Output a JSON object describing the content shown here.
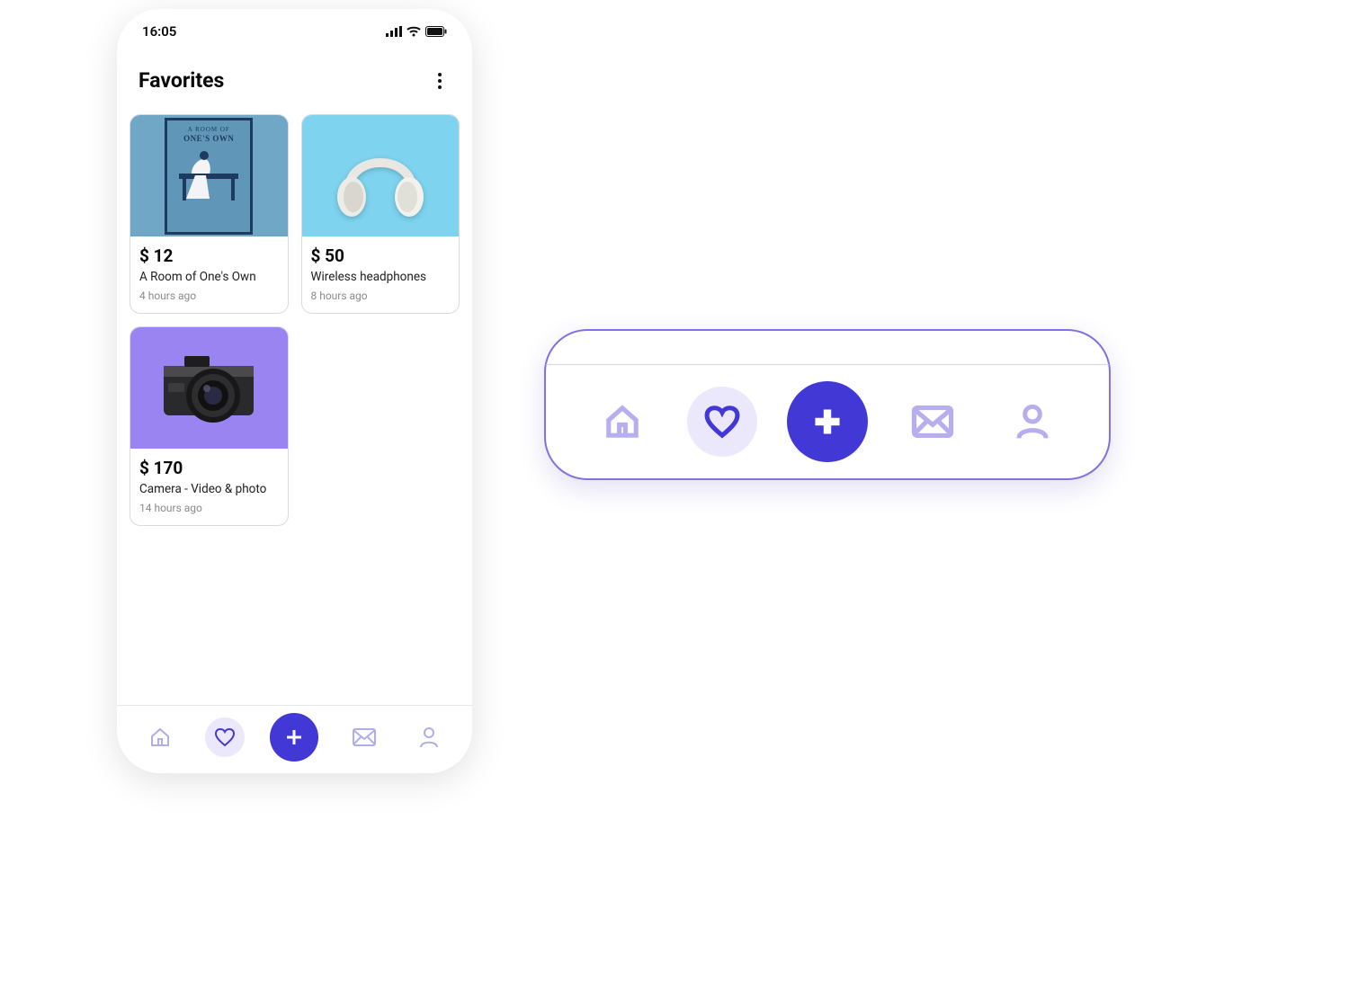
{
  "statusbar": {
    "time": "16:05"
  },
  "header": {
    "title": "Favorites"
  },
  "products": [
    {
      "price": "$ 12",
      "title": "A Room of One's Own",
      "time": "4 hours ago",
      "book_line1": "A ROOM OF",
      "book_line2": "ONE'S OWN"
    },
    {
      "price": "$ 50",
      "title": "Wireless headphones",
      "time": "8 hours ago"
    },
    {
      "price": "$ 170",
      "title": "Camera - Video & photo",
      "time": "14 hours ago"
    }
  ],
  "colors": {
    "accent": "#4238d6",
    "accent_light": "#ebe8fb",
    "nav_inactive": "#b0aee8",
    "panel_border": "#8271e5"
  },
  "nav": {
    "items": [
      "home",
      "favorites",
      "add",
      "messages",
      "profile"
    ],
    "active": "favorites"
  }
}
